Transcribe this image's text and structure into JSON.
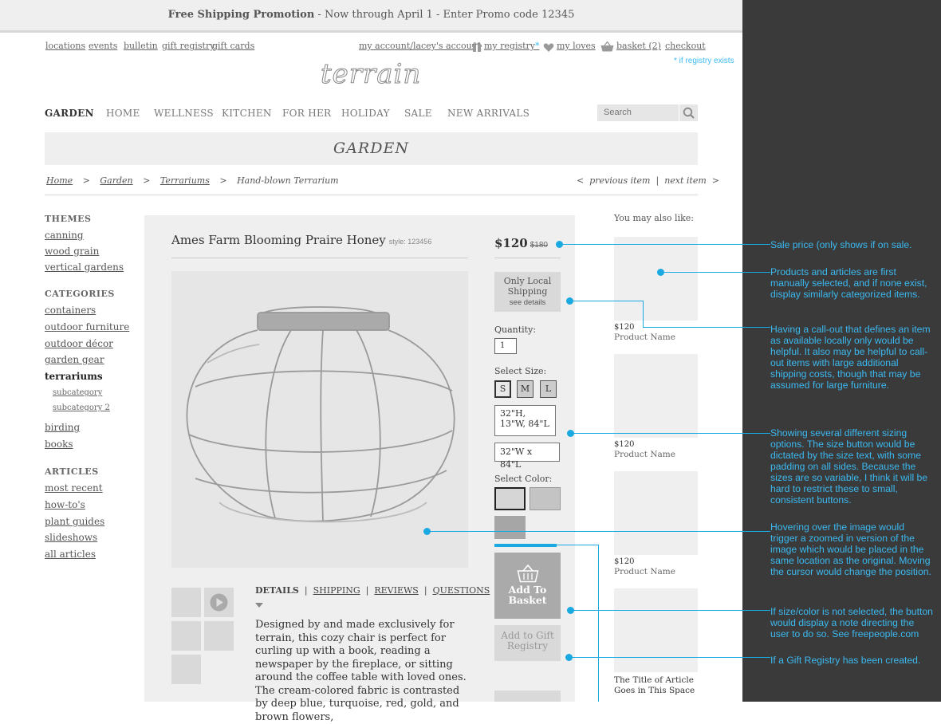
{
  "promo": {
    "title": "Free Shipping Promotion",
    "rest": " -  Now through April 1  -  Enter Promo code 12345"
  },
  "top_links": {
    "locations": "locations",
    "events": "events",
    "bulletin": "bulletin",
    "gift_registry": "gift registry",
    "gift_cards": "gift cards"
  },
  "account": {
    "my_account": "my account/lacey's account",
    "my_registry": "my registry",
    "registry_star": "*",
    "my_loves": "my loves",
    "basket": "basket (2)",
    "checkout": "checkout",
    "registry_note": "* if registry exists"
  },
  "logo": "terrain",
  "nav": [
    "GARDEN",
    "HOME",
    "WELLNESS",
    "KITCHEN",
    "FOR HER",
    "HOLIDAY",
    "SALE",
    "NEW ARRIVALS"
  ],
  "search": {
    "placeholder": "Search"
  },
  "banner": "GARDEN",
  "breadcrumb": {
    "home": "Home",
    "garden": "Garden",
    "terrariums": "Terrariums",
    "current": "Hand-blown Terrarium",
    "sep": ">",
    "prev": "<  previous item",
    "next": "next item  >",
    "divider": "|"
  },
  "sidebar": {
    "themes_heading": "THEMES",
    "themes": [
      "canning",
      "wood grain",
      "vertical gardens"
    ],
    "categories_heading": "CATEGORIES",
    "categories": [
      "containers",
      "outdoor furniture",
      "outdoor décor",
      "garden gear",
      "terrariums"
    ],
    "subcategories": [
      "subcategory",
      "subcategory 2"
    ],
    "categories2": [
      "birding",
      "books"
    ],
    "articles_heading": "ARTICLES",
    "articles": [
      "most recent",
      "how-to's",
      "plant guides",
      "slideshows",
      "all articles"
    ]
  },
  "product": {
    "title": "Ames Farm Blooming Praire Honey",
    "style": "style: 123456",
    "price": "$120",
    "old_price": "$180",
    "shipping_line1": "Only Local",
    "shipping_line2": "Shipping",
    "shipping_link": "see details",
    "quantity_label": "Quantity:",
    "quantity": "1",
    "size_label": "Select Size:",
    "sizes": [
      "S",
      "M",
      "L"
    ],
    "size_long1": "32\"H, 13\"W, 84\"L",
    "size_long2": "32\"W x 84\"L",
    "color_label": "Select Color:",
    "colors": [
      "#d6d6d6",
      "#c4c4c4",
      "#a6a6a6"
    ],
    "add_line1": "Add To",
    "add_line2": "Basket",
    "gift_line1": "Add to Gift",
    "gift_line2": "Registry",
    "tabs": [
      "DETAILS",
      "SHIPPING",
      "REVIEWS",
      "QUESTIONS"
    ],
    "tab_sep": "|",
    "description": "Designed by and made exclusively for terrain, this cozy chair is perfect for curling up with a book, reading a newspaper by the fireplace, or sitting around the coffee table with loved ones. The cream-colored fabric is contrasted by deep blue, turquoise, red, gold, and brown flowers,"
  },
  "related": {
    "heading": "You may also like:",
    "items": [
      {
        "price": "$120",
        "name": "Product Name"
      },
      {
        "price": "$120",
        "name": "Product Name"
      },
      {
        "price": "$120",
        "name": "Product Name"
      }
    ],
    "article_title": "The Title of Article Goes in This Space"
  },
  "notes": [
    "Sale price (only shows if on sale.",
    "Products and articles are first manually selected, and if none exist, display similarly categorized items.",
    "Having a call-out that defines an item as available locally only would be helpful. It also may be helpful to call-out items with large additional shipping costs, though that may be assumed for large furniture.",
    "Showing several different sizing options. The size button would be dictated by the size text, with some padding on all sides. Because the sizes are so variable, I think it will be hard to restrict these to small, consistent buttons.",
    "Hovering over the image would trigger a zoomed in version of the image which would be placed in the same location as the original. Moving the cursor would change the position.",
    "If size/color is not selected, the button would display a note directing the user to do so. See freepeople.com",
    "If a Gift Registry has been created."
  ],
  "colors": {
    "accent": "#1ba9e1",
    "note_text": "#3bb9f0",
    "dark_side": "#3a3a3a"
  }
}
